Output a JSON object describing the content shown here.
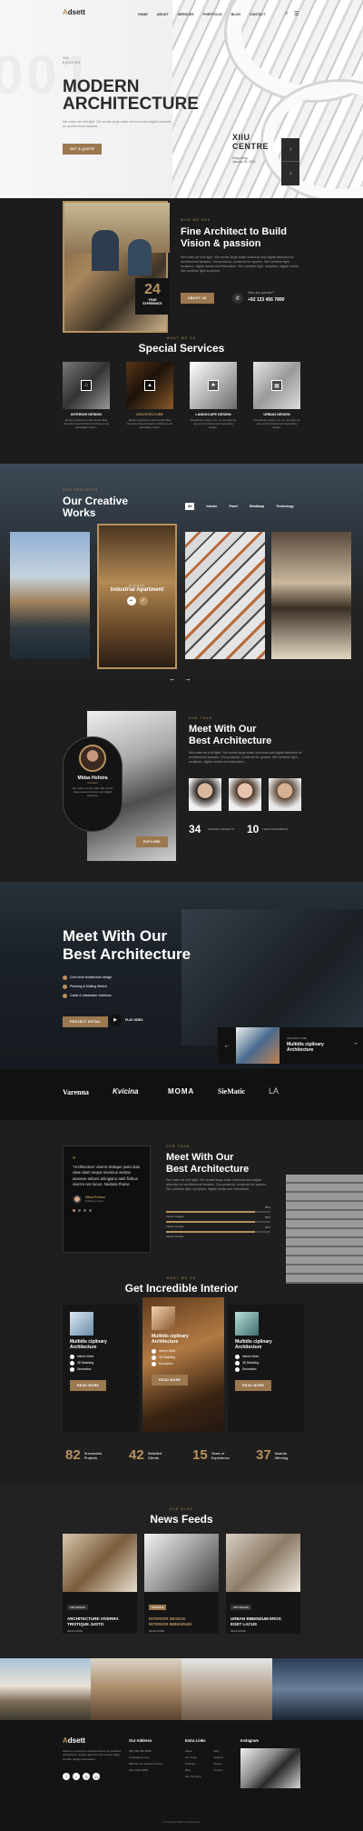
{
  "nav": {
    "logo": "Adsett",
    "items": [
      "HOME",
      "ABOUT",
      "SERVICES",
      "PORTFOLIO",
      "BLOG",
      "CONTACT"
    ]
  },
  "hero": {
    "kicker_top": "2020",
    "kicker": "BUILDING",
    "title_line1": "MODERN",
    "title_line2": "ARCHITECTURE",
    "text": "We make art with light. We create large-scale luminous and digital artworks for architectural facades.",
    "button": "GET A QUOTE",
    "ghost": "001",
    "card_title_line1": "XIIU",
    "card_title_line2": "CENTRE",
    "card_sub1": "Hong Kong",
    "card_sub2": "January 25, 2022"
  },
  "about": {
    "kicker": "WHO WE ARE",
    "title_line1": "Fine Architect to Build",
    "title_line2": "Vision & passion",
    "text": "We make art with light. We create large-scale luminous and digital artworks for architectural facades. Our products, construct for spaces. We combine light, sculpture, digital media and interaction. We combine light, sculpture, digital media, We combine light sculpture.",
    "button": "ABOUT US",
    "q_label": "Have any question?",
    "phone": "+92 123 456 7890",
    "years_num": "24",
    "years_label_1": "YEAR",
    "years_label_2": "EXPERIENCE"
  },
  "services": {
    "kicker": "WHAT WE DO",
    "title": "Special Services",
    "items": [
      {
        "name": "INTERIOR DESIGN",
        "text": "Modern Apartment also known Bay Houston Area Architect as Phoenix an affordable option."
      },
      {
        "name": "ARCHITECTURE",
        "text": "Modern Apartment also known Bay Houston Area Architect as Phoenix an affordable option."
      },
      {
        "name": "LANDSCAPE DESIGN",
        "text": "Excellence outlive mix, on remodel we use and functional and legendary design."
      },
      {
        "name": "URBAN DESIGN",
        "text": "Excellence outlive mix, on remodel we use and functional and legendary design."
      }
    ]
  },
  "works": {
    "kicker": "OUR PROJECTS",
    "title_line1": "Our Creative",
    "title_line2": "Works",
    "tabs": [
      "All",
      "Interior",
      "Panel",
      "Mindlamp",
      "Technology"
    ],
    "featured_label": "Industrial Apartment",
    "featured_kicker": "MODERN"
  },
  "team": {
    "name": "Midas Hofstra",
    "role": "Architect",
    "quote": "We make art with light. We create large-scale luminous and digital artworks.",
    "button": "EXPLORE",
    "kicker": "OUR TEAM",
    "title_line1": "Meet With Our",
    "title_line2": "Best Architecture",
    "text": "We make art with light. We create large-scale luminous and digital artworks for architectural facades. Our products, construct for spaces. We combine light, sculpture, digital media and interaction.",
    "stat1_num": "34",
    "stat1_label": "FINISHED PROJECTS",
    "stat2_num": "10",
    "stat2_label": "YEARS EXPERIENCE"
  },
  "meet": {
    "title_line1": "Meet With Our",
    "title_line2": "Best Architecture",
    "checks": [
      "Core level architecture design",
      "Planning & Making Sketch",
      "Guide & Installation Solutions"
    ],
    "button": "PROJECT DETAIL",
    "play_label": "PLAY VIDEO",
    "card_kicker": "ARCHITECTURE",
    "card_title_line1": "Multidis ciplinary",
    "card_title_line2": "Architecture"
  },
  "brands": [
    "Varenna",
    "Kvicina",
    "MOMA",
    "SieMatic",
    "LA"
  ],
  "testimonial": {
    "quote": "“Architecture viverra tristique justo duis vitae diam neque nivamus aestan ateueve artines ariingianu ateli finibus viverra nec lacus. Nedana thame",
    "author": "Sillas Puhruz",
    "author_role": "Building Owner",
    "kicker": "OUR TEAM",
    "title_line1": "Meet With Our",
    "title_line2": "Best Architecture",
    "text": "We make art with light. We create large-scale luminous and digital artworks for architectural facades. Our products, construct for spaces. We combine light, sculpture, digital media and interaction.",
    "bars": [
      {
        "label": "Interior Design",
        "value": 0.85,
        "pct": "85%"
      },
      {
        "label": "Interior Design",
        "value": 0.85,
        "pct": "85%"
      },
      {
        "label": "Interior Design",
        "value": 0.85,
        "pct": "85%"
      }
    ]
  },
  "interior": {
    "kicker": "WHAT WE DO",
    "title": "Get Incredible Interior",
    "cards": [
      {
        "title_line1": "Multidis ciplinary",
        "title_line2": "Architecture",
        "items": [
          "Interior Work",
          "3D Modeling",
          "Decoration"
        ],
        "button": "READ MORE"
      },
      {
        "title_line1": "Multidis ciplinary",
        "title_line2": "Architecture",
        "items": [
          "Interior Work",
          "3D Modeling",
          "Decoration"
        ],
        "button": "READ MORE"
      },
      {
        "title_line1": "Multidis ciplinary",
        "title_line2": "Architecture",
        "items": [
          "Interior Work",
          "3D Modeling",
          "Decoration"
        ],
        "button": "READ MORE"
      }
    ],
    "stats": [
      {
        "num": "82",
        "label_1": "Successful",
        "label_2": "Projects"
      },
      {
        "num": "42",
        "label_1": "Satisfied",
        "label_2": "Clients"
      },
      {
        "num": "15",
        "label_1": "Years of",
        "label_2": "Experience"
      },
      {
        "num": "37",
        "label_1": "Awards",
        "label_2": "Winning"
      }
    ]
  },
  "news": {
    "kicker": "OUR BLOG",
    "title": "News Feeds",
    "posts": [
      {
        "tag": "ART DESIGN",
        "title_line1": "ARCHITECTURE VIVERRA",
        "title_line2": "TRISTIQUE JUSTO",
        "more": "READ MORE"
      },
      {
        "tag": "INTERIOR",
        "title_line1": "INTERIOR DESIGN",
        "title_line2": "INTERIOR BIBENDUM",
        "more": "READ MORE"
      },
      {
        "tag": "ART DESIGN",
        "title_line1": "URBAN BIBENDUM EROS",
        "title_line2": "EGET LACUS",
        "more": "READ MORE"
      }
    ]
  },
  "footer": {
    "logo": "Adsett",
    "about": "Adsett is a premium architect theme for architect, architecture, design agencies and a wide range of other design businesses.",
    "address_title": "Our Address",
    "address_lines": [
      "(89) 999 999 9999",
      "info@adsett.com",
      "8900 Ponce Gardens Street,",
      "USA 1000 9800"
    ],
    "links_title": "Extra Links",
    "links_col1": [
      "About",
      "Our Team",
      "Portfolio",
      "Blog",
      "Our Services"
    ],
    "links_col2": [
      "Help",
      "Support",
      "Clients",
      "Contact"
    ],
    "instagram_title": "Instagram",
    "copyright": "© copyright 2022 by adsett.com"
  },
  "colors": {
    "accent": "#b7925e",
    "dark": "#1b1b1b",
    "button": "#9b7850"
  }
}
